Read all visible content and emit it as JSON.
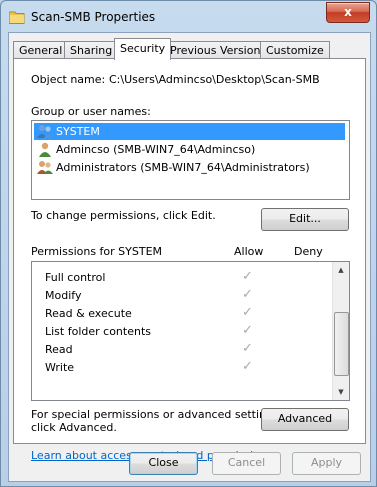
{
  "window": {
    "title": "Scan-SMB Properties",
    "close_glyph": "x"
  },
  "tabs": [
    {
      "label": "General"
    },
    {
      "label": "Sharing"
    },
    {
      "label": "Security",
      "active": true
    },
    {
      "label": "Previous Versions"
    },
    {
      "label": "Customize"
    }
  ],
  "security": {
    "object_name_label": "Object name:",
    "object_name_value": "C:\\Users\\Admincso\\Desktop\\Scan-SMB",
    "group_label": "Group or user names:",
    "users": [
      {
        "name": "SYSTEM",
        "icon": "users-group-icon",
        "selected": true
      },
      {
        "name": "Admincso (SMB-WIN7_64\\Admincso)",
        "icon": "user-icon",
        "selected": false
      },
      {
        "name": "Administrators (SMB-WIN7_64\\Administrators)",
        "icon": "users-group-icon",
        "selected": false
      }
    ],
    "change_text": "To change permissions, click Edit.",
    "edit_button": "Edit...",
    "permissions_for": "Permissions for SYSTEM",
    "allow_header": "Allow",
    "deny_header": "Deny",
    "permissions": [
      {
        "name": "Full control",
        "allow": true,
        "deny": false
      },
      {
        "name": "Modify",
        "allow": true,
        "deny": false
      },
      {
        "name": "Read & execute",
        "allow": true,
        "deny": false
      },
      {
        "name": "List folder contents",
        "allow": true,
        "deny": false
      },
      {
        "name": "Read",
        "allow": true,
        "deny": false
      },
      {
        "name": "Write",
        "allow": true,
        "deny": false
      }
    ],
    "check_glyph": "✓",
    "special_text_1": "For special permissions or advanced settings,",
    "special_text_2": "click Advanced.",
    "advanced_button": "Advanced",
    "learn_link": "Learn about access control and permissions"
  },
  "footer": {
    "close": "Close",
    "cancel": "Cancel",
    "apply": "Apply"
  },
  "colors": {
    "selection": "#3399ff",
    "link": "#0066cc",
    "close_button": "#c23c24"
  }
}
